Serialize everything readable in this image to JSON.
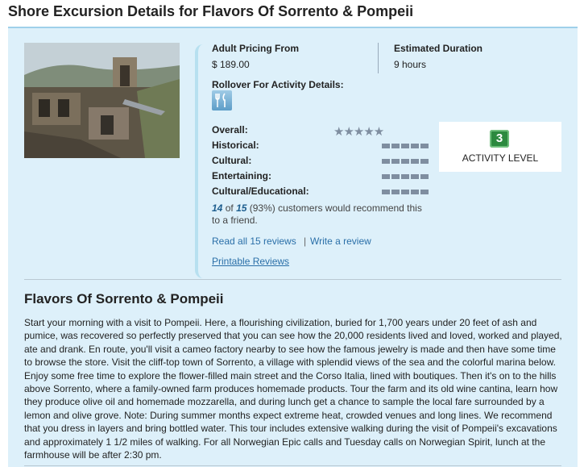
{
  "page": {
    "title": "Shore Excursion Details for Flavors Of Sorrento & Pompeii"
  },
  "pricing": {
    "label": "Adult Pricing From",
    "value": "$ 189.00"
  },
  "duration": {
    "label": "Estimated Duration",
    "value": "9 hours"
  },
  "activity": {
    "rollover_label": "Rollover For Activity Details:",
    "icon": "dining-icon"
  },
  "ratings": {
    "stars": "★★★★★",
    "items": [
      {
        "label": "Overall:"
      },
      {
        "label": "Historical:"
      },
      {
        "label": "Cultural:"
      },
      {
        "label": "Entertaining:"
      },
      {
        "label": "Cultural/Educational:"
      }
    ]
  },
  "activity_level": {
    "number": "3",
    "label": "ACTIVITY LEVEL",
    "color": "#2c8a3f"
  },
  "recommend": {
    "count": "14",
    "of_word": "of",
    "total": "15",
    "text": "(93%) customers would recommend this to a friend."
  },
  "links": {
    "read_reviews": "Read all 15 reviews",
    "separator": "|",
    "write_review": "Write a review",
    "printable_reviews": "Printable Reviews"
  },
  "description": {
    "title": "Flavors Of Sorrento & Pompeii",
    "body": "Start your morning with a visit to Pompeii. Here, a flourishing civilization, buried for 1,700 years under 20 feet of ash and pumice, was recovered so perfectly preserved that you can see how the 20,000 residents lived and loved, worked and played, ate and drank. En route, you'll visit a cameo factory nearby to see how the famous jewelry is made and then have some time to browse the store. Visit the cliff-top town of Sorrento, a village with splendid views of the sea and the colorful marina below. Enjoy some free time to explore the flower-filled main street and the Corso Italia, lined with boutiques. Then it's on to the hills above Sorrento, where a family-owned farm produces homemade products. Tour the farm and its old wine cantina, learn how they produce olive oil and homemade mozzarella, and during lunch get a chance to sample the local fare surrounded by a lemon and olive grove. Note: During summer months expect extreme heat, crowded venues and long lines. We recommend that you dress in layers and bring bottled water. This tour includes extensive walking during the visit of Pompeii's excavations and approximately 1 1/2 miles of walking. For all Norwegian Epic calls and Tuesday calls on Norwegian Spirit, lunch at the farmhouse will be after 2:30 pm."
  }
}
